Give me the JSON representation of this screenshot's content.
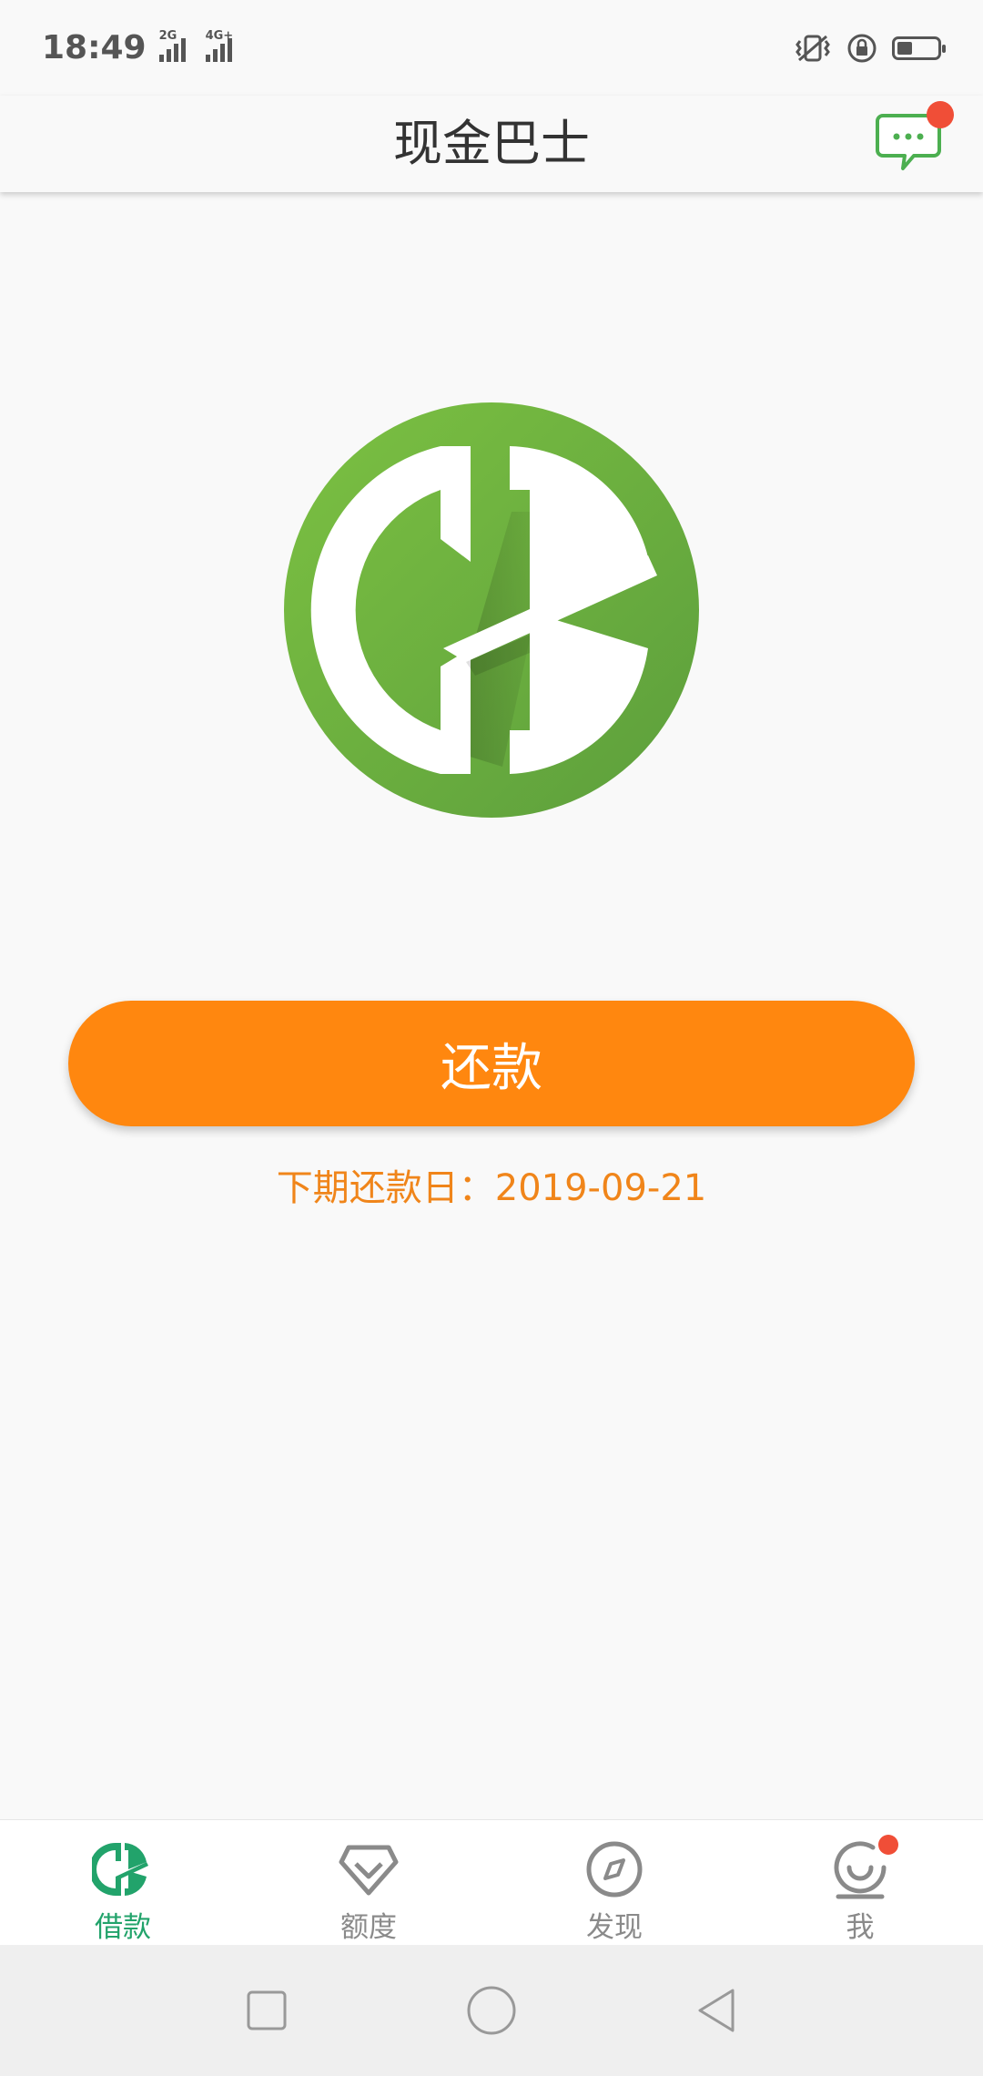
{
  "status_bar": {
    "time": "18:49",
    "sim1_network": "2G",
    "sim2_network": "4G+",
    "icons": [
      "vibrate-icon",
      "rotation-lock-icon",
      "battery-icon"
    ]
  },
  "header": {
    "title": "现金巴士",
    "message_icon": "message-icon",
    "has_unread": true
  },
  "main": {
    "logo": "cashbus-logo",
    "repay_button_label": "还款",
    "next_due_label": "下期还款日：2019-09-21"
  },
  "bottom_nav": {
    "active_index": 0,
    "tabs": [
      {
        "label": "借款",
        "icon": "loan-logo-icon"
      },
      {
        "label": "额度",
        "icon": "diamond-icon"
      },
      {
        "label": "发现",
        "icon": "compass-icon"
      },
      {
        "label": "我",
        "icon": "smile-profile-icon",
        "badge": true
      }
    ]
  },
  "system_nav": {
    "buttons": [
      "recents-button",
      "home-button",
      "back-button"
    ]
  },
  "colors": {
    "brand_green": "#6ab43c",
    "accent_orange": "#ff870f",
    "active_tab_green": "#22a36b",
    "badge_red": "#f04e37"
  }
}
